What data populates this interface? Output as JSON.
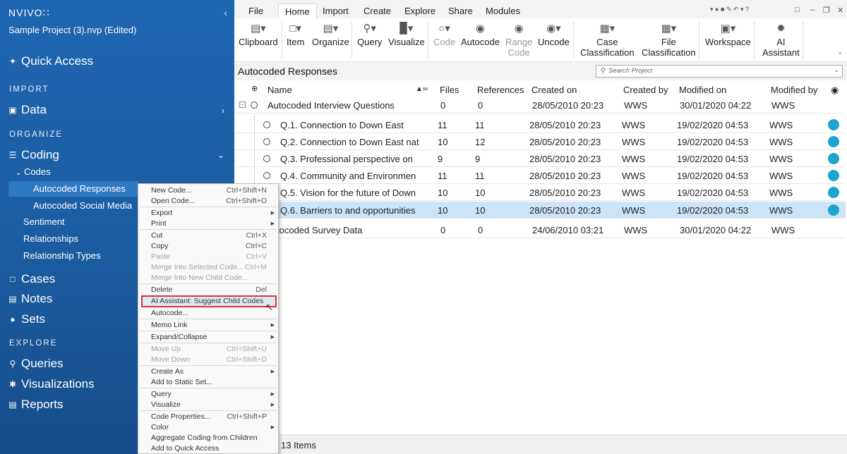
{
  "sidebar": {
    "logo": "NVIVO∷",
    "project": "Sample Project (3).nvp (Edited)",
    "quick_access": "Quick Access",
    "sections": {
      "import": "IMPORT",
      "organize": "ORGANIZE",
      "explore": "EXPLORE"
    },
    "data": "Data",
    "coding": "Coding",
    "codes": "Codes",
    "autocoded_responses": "Autocoded Responses",
    "autocoded_social": "Autocoded Social Media",
    "sentiment": "Sentiment",
    "relationships": "Relationships",
    "relationship_types": "Relationship Types",
    "cases": "Cases",
    "notes": "Notes",
    "sets": "Sets",
    "queries": "Queries",
    "visualizations": "Visualizations",
    "reports": "Reports"
  },
  "tabs": [
    "File",
    "Home",
    "Import",
    "Create",
    "Explore",
    "Share",
    "Modules"
  ],
  "ribbon": {
    "clipboard": "Clipboard",
    "item": "Item",
    "organize": "Organize",
    "query": "Query",
    "visualize": "Visualize",
    "code": "Code",
    "autocode": "Autocode",
    "range": "Range",
    "range2": "Code",
    "uncode": "Uncode",
    "case1": "Case",
    "case2": "Classification",
    "file1": "File",
    "file2": "Classification",
    "workspace": "Workspace",
    "ai1": "AI",
    "ai2": "Assistant"
  },
  "main": {
    "title": "Autocoded Responses",
    "search_placeholder": "Search Project",
    "columns": [
      "Name",
      "Files",
      "References",
      "Created on",
      "Created by",
      "Modified on",
      "Modified by"
    ],
    "rows": [
      {
        "name": "Autocoded Interview Questions",
        "files": "0",
        "refs": "0",
        "created": "28/05/2010 20:23",
        "by": "WWS",
        "modified": "30/01/2020 04:22",
        "mby": "WWS"
      },
      {
        "name": "Q.1. Connection to Down East",
        "files": "11",
        "refs": "11",
        "created": "28/05/2010 20:23",
        "by": "WWS",
        "modified": "19/02/2020 04:53",
        "mby": "WWS"
      },
      {
        "name": "Q.2. Connection to Down East nat",
        "files": "10",
        "refs": "12",
        "created": "28/05/2010 20:23",
        "by": "WWS",
        "modified": "19/02/2020 04:53",
        "mby": "WWS"
      },
      {
        "name": "Q.3. Professional perspective on",
        "files": "9",
        "refs": "9",
        "created": "28/05/2010 20:23",
        "by": "WWS",
        "modified": "19/02/2020 04:53",
        "mby": "WWS"
      },
      {
        "name": "Q.4. Community and Environmen",
        "files": "11",
        "refs": "11",
        "created": "28/05/2010 20:23",
        "by": "WWS",
        "modified": "19/02/2020 04:53",
        "mby": "WWS"
      },
      {
        "name": "Q.5. Vision for the future of Down",
        "files": "10",
        "refs": "10",
        "created": "28/05/2010 20:23",
        "by": "WWS",
        "modified": "19/02/2020 04:53",
        "mby": "WWS"
      },
      {
        "name": "Q.6. Barriers to and opportunities",
        "files": "10",
        "refs": "10",
        "created": "28/05/2010 20:23",
        "by": "WWS",
        "modified": "19/02/2020 04:53",
        "mby": "WWS"
      },
      {
        "name": "tocoded Survey Data",
        "files": "0",
        "refs": "0",
        "created": "24/06/2010 03:21",
        "by": "WWS",
        "modified": "30/01/2020 04:22",
        "mby": "WWS"
      }
    ],
    "status": "13 Items"
  },
  "menu": {
    "new_code": "New Code...",
    "new_code_sc": "Ctrl+Shift+N",
    "open_code": "Open Code...",
    "open_code_sc": "Ctrl+Shift+O",
    "export": "Export",
    "print": "Print",
    "cut": "Cut",
    "cut_sc": "Ctrl+X",
    "copy": "Copy",
    "copy_sc": "Ctrl+C",
    "paste": "Paste",
    "paste_sc": "Ctrl+V",
    "merge_sel": "Merge Into Selected Code...",
    "merge_sel_sc": "Ctrl+M",
    "merge_new": "Merge Into New Child Code...",
    "delete": "Delete",
    "delete_sc": "Del",
    "ai_suggest": "AI Assistant: Suggest Child Codes",
    "autocode": "Autocode...",
    "memo_link": "Memo Link",
    "expand": "Expand/Collapse",
    "move_up": "Move Up",
    "move_up_sc": "Ctrl+Shift+U",
    "move_down": "Move Down",
    "move_down_sc": "Ctrl+Shift+D",
    "create_as": "Create As",
    "add_static": "Add to Static Set...",
    "query": "Query",
    "visualize": "Visualize",
    "code_props": "Code Properties...",
    "code_props_sc": "Ctrl+Shift+P",
    "color": "Color",
    "aggregate": "Aggregate Coding from Children",
    "add_quick": "Add to Quick Access"
  },
  "colors": {
    "sidebar": "#1f66b1",
    "selected_row": "#cce4f7",
    "dot": "#1ea2cf",
    "highlight_border": "#e0322e"
  }
}
